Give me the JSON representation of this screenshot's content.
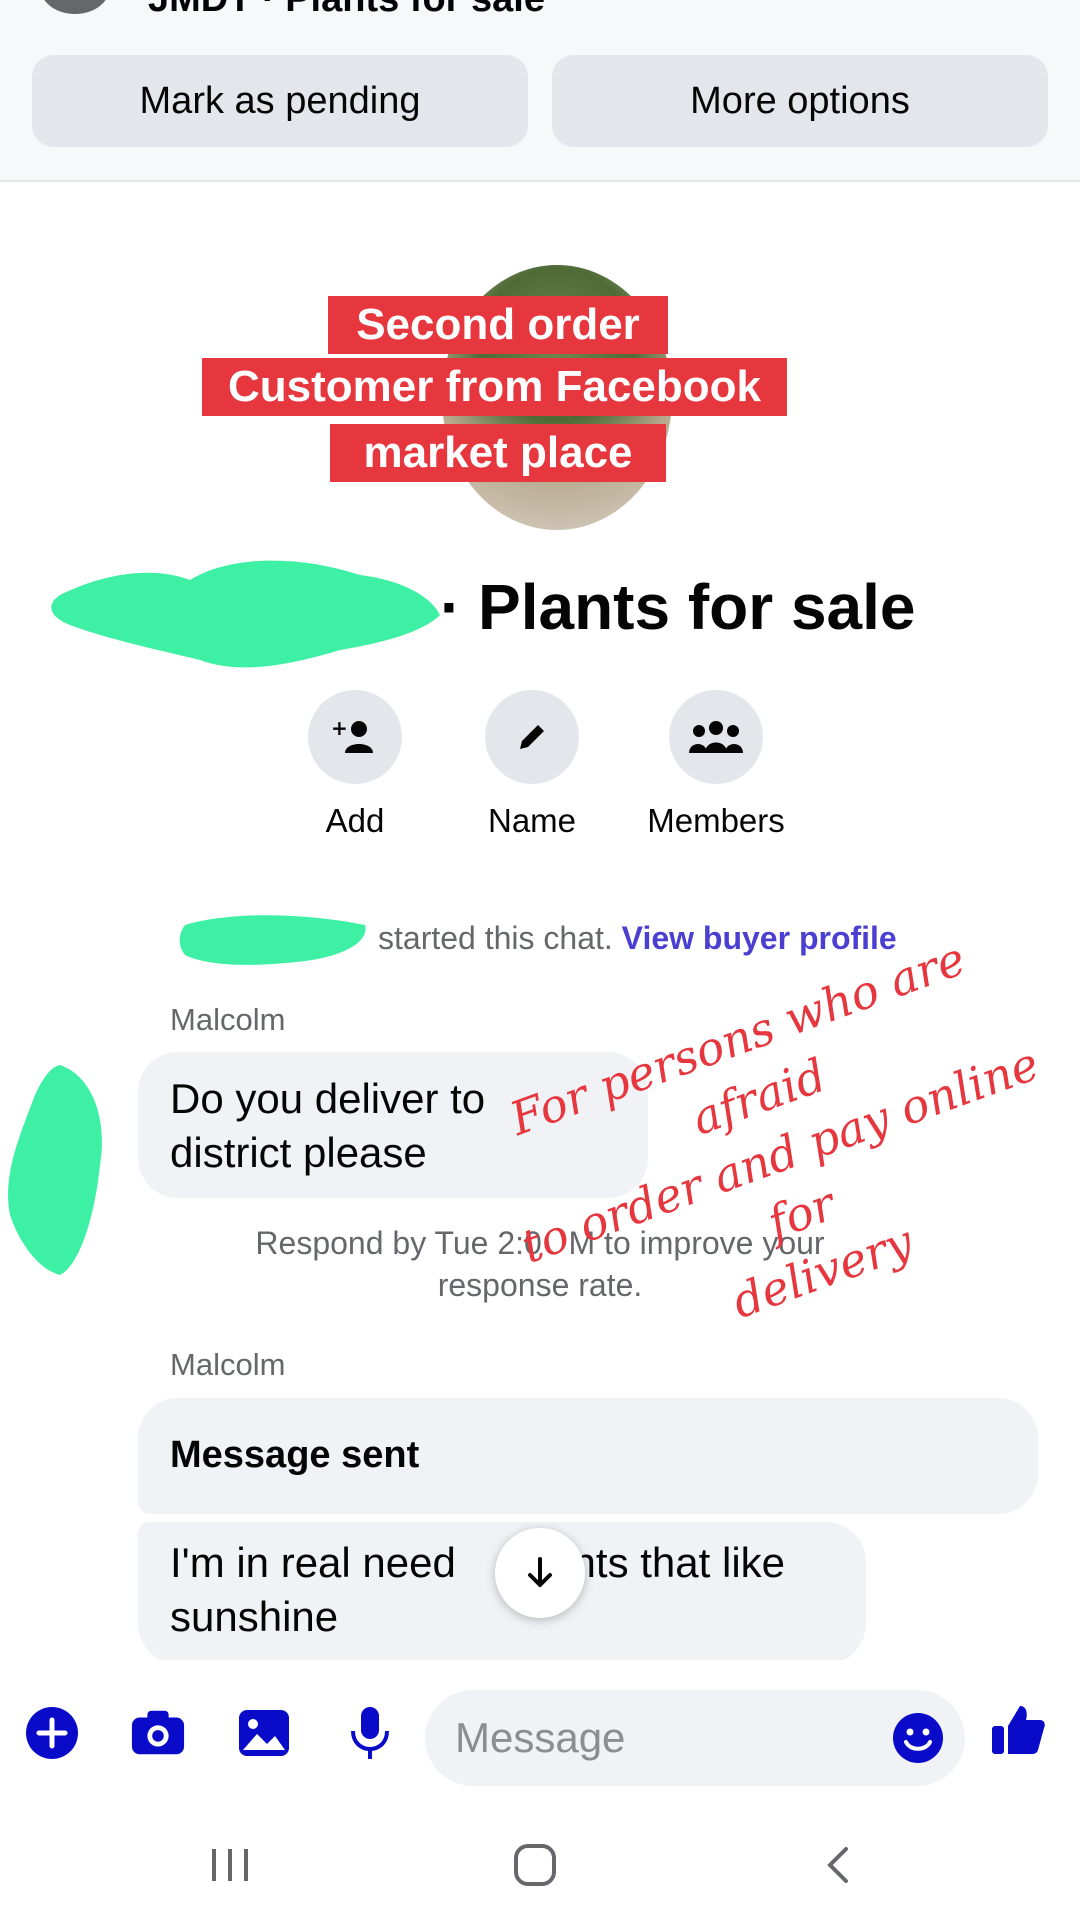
{
  "header": {
    "title": "JMDT · Plants for sale",
    "mark_pending": "Mark as pending",
    "more_options": "More options"
  },
  "overlay": {
    "line1": "Second order",
    "line2": "Customer from Facebook",
    "line3": "market place"
  },
  "group": {
    "title": "Plants for sale",
    "actions": [
      {
        "label": "Add",
        "icon": "add-person-icon"
      },
      {
        "label": "Name",
        "icon": "pencil-icon"
      },
      {
        "label": "Members",
        "icon": "members-icon"
      }
    ]
  },
  "chat": {
    "started_text": "started this chat.",
    "view_profile": "View buyer profile",
    "messages": [
      {
        "sender": "Malcolm",
        "line1": "Do you deliver to",
        "line2": "district please"
      },
      {
        "sender": "Malcolm",
        "bold": "Message sent",
        "line1": "I'm in real need",
        "line1b": "ants that like",
        "line2": "sunshine"
      }
    ],
    "respond_line1": "Respond by Tue 2:0",
    "respond_line1b": "M to improve your",
    "respond_line2": "response rate."
  },
  "annotation": {
    "line1": "For persons who are afraid",
    "line2": "to order and pay online for",
    "line3": "delivery"
  },
  "composer": {
    "placeholder": "Message"
  },
  "colors": {
    "accent": "#0a0ac9",
    "overlay_red": "#e6373f",
    "scribble_green": "#3df0a4",
    "link_purple": "#4a3fd1"
  }
}
